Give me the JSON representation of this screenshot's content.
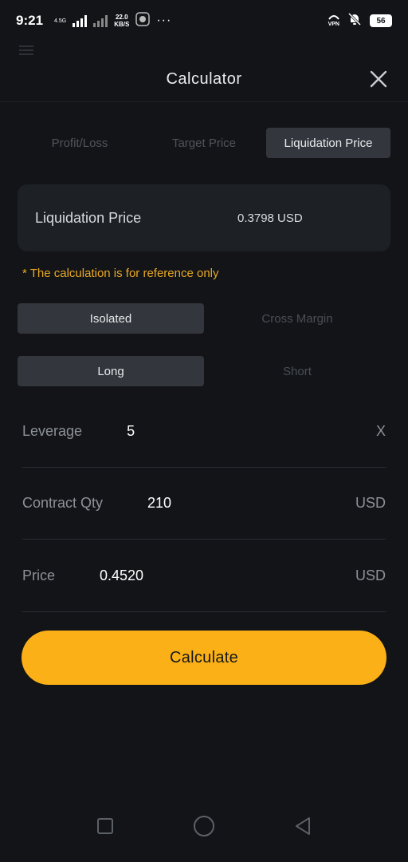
{
  "status_bar": {
    "time": "9:21",
    "net_type": "4.5G",
    "speed_value": "22.0",
    "speed_unit": "KB/S",
    "vpn": "VPN",
    "battery": "56"
  },
  "modal": {
    "title": "Calculator"
  },
  "tabs": [
    {
      "label": "Profit/Loss",
      "active": false
    },
    {
      "label": "Target Price",
      "active": false
    },
    {
      "label": "Liquidation Price",
      "active": true
    }
  ],
  "result": {
    "label": "Liquidation Price",
    "value": "0.3798 USD"
  },
  "disclaimer": "* The calculation is for reference only",
  "margin_mode": {
    "options": [
      "Isolated",
      "Cross Margin"
    ],
    "selected": "Isolated"
  },
  "side": {
    "options": [
      "Long",
      "Short"
    ],
    "selected": "Long"
  },
  "fields": {
    "leverage": {
      "label": "Leverage",
      "value": "5",
      "unit": "X"
    },
    "contract_qty": {
      "label": "Contract Qty",
      "value": "210",
      "unit": "USD"
    },
    "price": {
      "label": "Price",
      "value": "0.4520",
      "unit": "USD"
    }
  },
  "calculate_label": "Calculate",
  "colors": {
    "accent": "#fcb017",
    "disclaimer": "#e9a823",
    "background": "#121418"
  }
}
